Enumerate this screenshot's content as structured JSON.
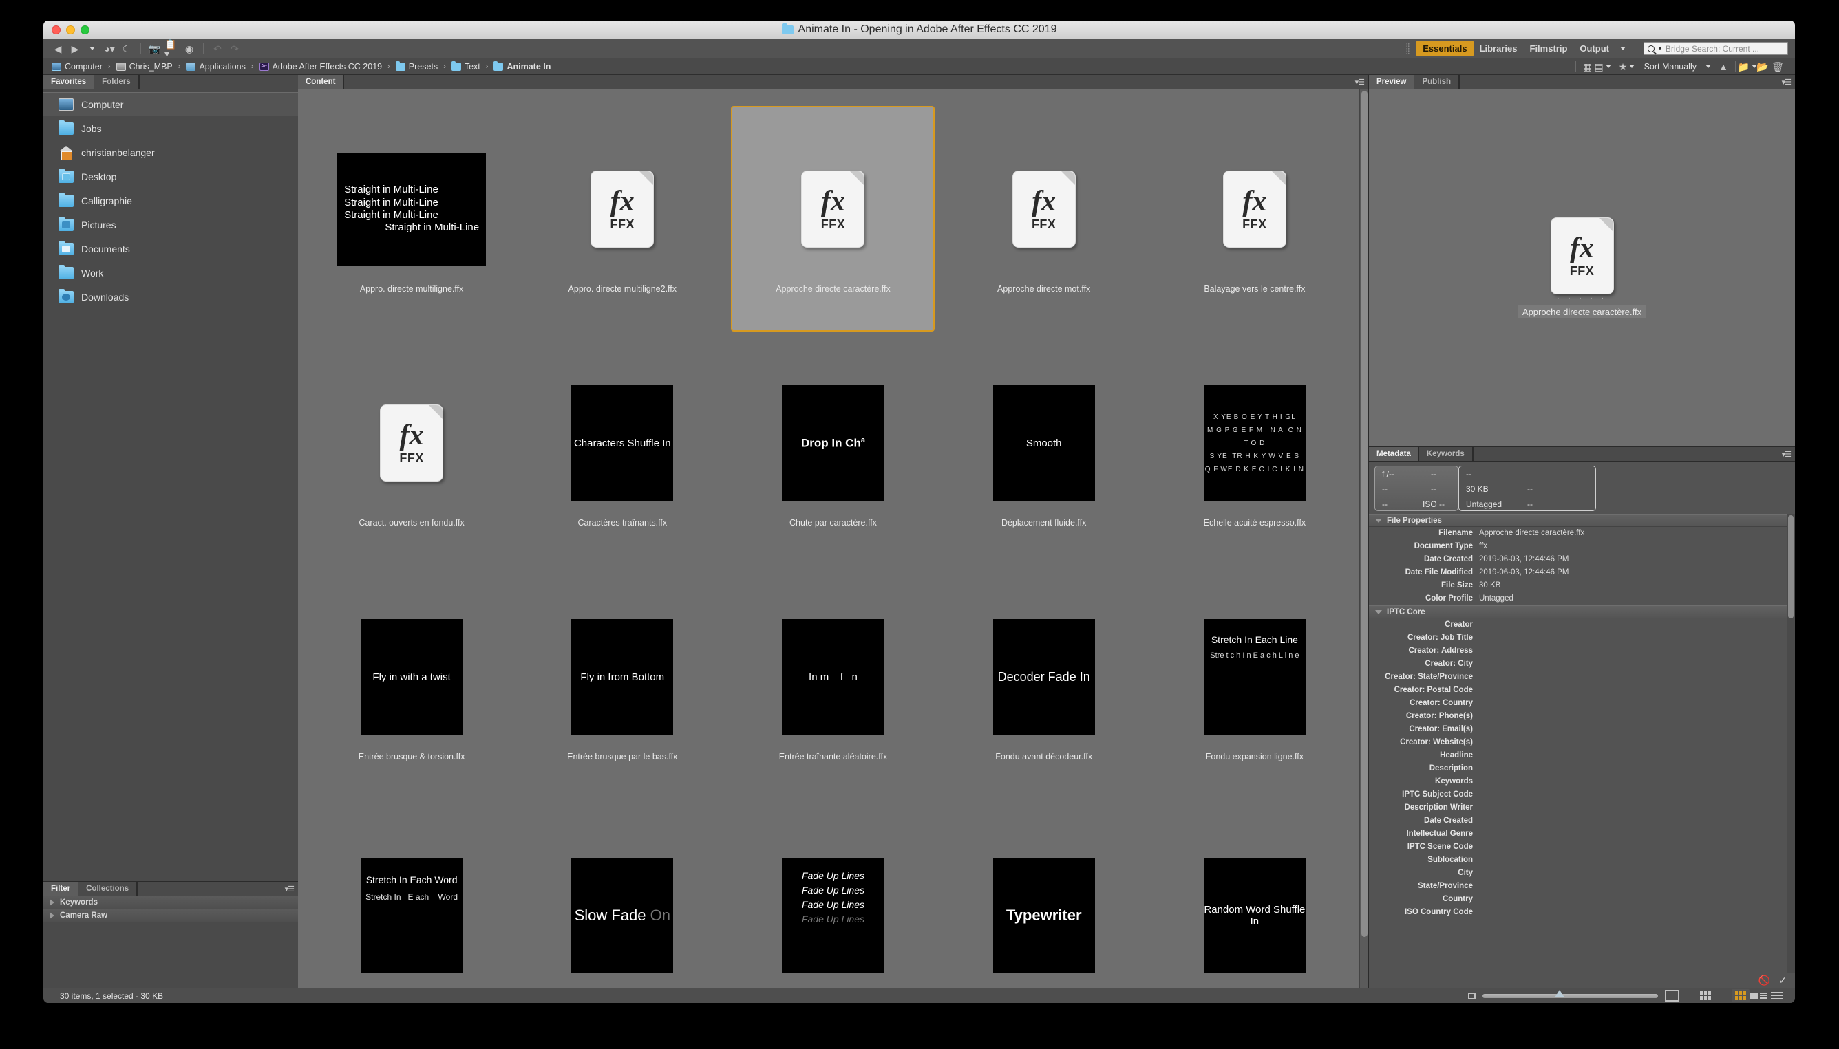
{
  "window": {
    "title": "Animate In - Opening in Adobe After Effects CC 2019"
  },
  "toolbar": {
    "workspaces": [
      {
        "label": "Essentials",
        "active": true
      },
      {
        "label": "Libraries",
        "active": false
      },
      {
        "label": "Filmstrip",
        "active": false
      },
      {
        "label": "Output",
        "active": false
      }
    ],
    "search_placeholder": "Bridge Search: Current ...",
    "icons": [
      "back-arrow-icon",
      "forward-arrow-icon",
      "recent-dropdown-icon",
      "reveal-icon",
      "boomerang-icon",
      "get-photos-camera-icon",
      "refine-copy-icon",
      "open-in-camera-raw-icon",
      "rotate-ccw-icon",
      "rotate-cw-icon"
    ]
  },
  "pathbar": {
    "crumbs": [
      {
        "label": "Computer",
        "icon": "computer-icon"
      },
      {
        "label": "Chris_MBP",
        "icon": "disk-icon"
      },
      {
        "label": "Applications",
        "icon": "applications-icon"
      },
      {
        "label": "Adobe After Effects CC 2019",
        "icon": "after-effects-icon"
      },
      {
        "label": "Presets",
        "icon": "folder-icon"
      },
      {
        "label": "Text",
        "icon": "folder-icon"
      },
      {
        "label": "Animate In",
        "icon": "folder-icon"
      }
    ],
    "separator": "›"
  },
  "content_toolbar": {
    "thumbnail_quality_label": "thumbnail-quality-icon",
    "preview_quality_label": "preview-quality-icon",
    "rating_filter_label": "star-filter-icon",
    "sort_label": "Sort Manually",
    "sort_direction": "ascending",
    "new_folder_label": "new-folder-icon",
    "delete_label": "trash-icon"
  },
  "sidebar": {
    "tabs": [
      {
        "label": "Favorites",
        "active": true
      },
      {
        "label": "Folders",
        "active": false
      }
    ],
    "items": [
      {
        "label": "Computer",
        "icon": "computer-icon",
        "selected": true
      },
      {
        "label": "Jobs",
        "icon": "folder-icon",
        "selected": false
      },
      {
        "label": "christianbelanger",
        "icon": "home-icon",
        "selected": false
      },
      {
        "label": "Desktop",
        "icon": "desktop-folder-icon",
        "selected": false
      },
      {
        "label": "Calligraphie",
        "icon": "folder-icon",
        "selected": false
      },
      {
        "label": "Pictures",
        "icon": "pictures-folder-icon",
        "selected": false
      },
      {
        "label": "Documents",
        "icon": "documents-folder-icon",
        "selected": false
      },
      {
        "label": "Work",
        "icon": "folder-icon",
        "selected": false
      },
      {
        "label": "Downloads",
        "icon": "downloads-folder-icon",
        "selected": false
      }
    ]
  },
  "filter_panel": {
    "tabs": [
      {
        "label": "Filter",
        "active": true
      },
      {
        "label": "Collections",
        "active": false
      }
    ],
    "rows": [
      {
        "label": "Keywords"
      },
      {
        "label": "Camera Raw"
      }
    ]
  },
  "content": {
    "tabs": [
      {
        "label": "Content",
        "active": true
      }
    ],
    "items": [
      {
        "caption": "Appro. directe multiligne.ffx",
        "thumb": "text-lines",
        "selected": false,
        "lines": [
          "Straight in Multi-Line",
          "Straight in Multi-Line",
          "Straight in Multi-Line",
          "Straight in Multi-Line"
        ],
        "indent_last": true
      },
      {
        "caption": "Appro. directe multiligne2.ffx",
        "thumb": "ffx-icon",
        "selected": false,
        "ffx_label": "FFX"
      },
      {
        "caption": "Approche directe caractère.ffx",
        "thumb": "ffx-icon",
        "selected": true,
        "ffx_label": "FFX"
      },
      {
        "caption": "Approche directe mot.ffx",
        "thumb": "ffx-icon",
        "selected": false,
        "ffx_label": "FFX"
      },
      {
        "caption": "Balayage vers le centre.ffx",
        "thumb": "ffx-icon",
        "selected": false,
        "ffx_label": "FFX"
      },
      {
        "caption": "Caract. ouverts en fondu.ffx",
        "thumb": "ffx-icon",
        "selected": false,
        "ffx_label": "FFX"
      },
      {
        "caption": "Caractères traînants.ffx",
        "thumb": "text-center",
        "selected": false,
        "text": "Characters Shuffle In"
      },
      {
        "caption": "Chute par caractère.ffx",
        "thumb": "drop-in",
        "selected": false,
        "text": "Drop In Ch",
        "sup": "a"
      },
      {
        "caption": "Déplacement fluide.ffx",
        "thumb": "smooth",
        "selected": false,
        "text": "Smooth"
      },
      {
        "caption": "Echelle acuité espresso.ffx",
        "thumb": "scatter",
        "selected": false,
        "scatter": [
          "X YE B O E Y T H I GL",
          "M G P G E F M I N A  C N T O D",
          "S YE  TR H K Y W V E S",
          "Q F WE D K E C I C I K I N"
        ]
      },
      {
        "caption": "Entrée brusque & torsion.ffx",
        "thumb": "text-center",
        "selected": false,
        "text": "Fly in with a twist"
      },
      {
        "caption": "Entrée brusque par le bas.ffx",
        "thumb": "text-center",
        "selected": false,
        "text": "Fly in from Bottom"
      },
      {
        "caption": "Entrée traînante aléatoire.ffx",
        "thumb": "text-center",
        "selected": false,
        "text": "In m    f   n"
      },
      {
        "caption": "Fondu avant décodeur.ffx",
        "thumb": "text-center",
        "selected": false,
        "text": "Decoder Fade In"
      },
      {
        "caption": "Fondu expansion ligne.ffx",
        "thumb": "stretch-line",
        "selected": false,
        "line1": "Stretch In Each Line",
        "line2": "Stre t c h  I n  E a c h L i n e"
      },
      {
        "caption": "",
        "thumb": "stretch-word",
        "selected": false,
        "line1": "Stretch In Each Word",
        "line2": "Stretch  In   E ach    Word"
      },
      {
        "caption": "",
        "thumb": "slow-fade",
        "selected": false,
        "text": "Slow Fade",
        "faded": "On"
      },
      {
        "caption": "",
        "thumb": "fade-up-lines",
        "selected": false,
        "lines": [
          "Fade Up Lines",
          "Fade Up Lines",
          "Fade Up Lines",
          "Fade Up Lines"
        ]
      },
      {
        "caption": "",
        "thumb": "text-center",
        "selected": false,
        "text": "Typewriter"
      },
      {
        "caption": "",
        "thumb": "text-center",
        "selected": false,
        "text": "Random Word Shuffle In"
      }
    ]
  },
  "preview": {
    "tabs": [
      {
        "label": "Preview",
        "active": true
      },
      {
        "label": "Publish",
        "active": false
      }
    ],
    "ffx_label": "FFX",
    "caption": "Approche directe caractère.ffx",
    "dots": "· · · · ·"
  },
  "metadata": {
    "tabs": [
      {
        "label": "Metadata",
        "active": true
      },
      {
        "label": "Keywords",
        "active": false
      }
    ],
    "plate_left": [
      "f /--",
      "--",
      "--",
      "--",
      "--",
      "ISO --"
    ],
    "plate_right": [
      "--",
      "",
      "30 KB",
      "--",
      "Untagged",
      "--"
    ],
    "sections": [
      {
        "title": "File Properties",
        "rows": [
          {
            "key": "Filename",
            "value": "Approche directe caractère.ffx"
          },
          {
            "key": "Document Type",
            "value": "ffx"
          },
          {
            "key": "Date Created",
            "value": "2019-06-03, 12:44:46 PM"
          },
          {
            "key": "Date File Modified",
            "value": "2019-06-03, 12:44:46 PM"
          },
          {
            "key": "File Size",
            "value": "30 KB"
          },
          {
            "key": "Color Profile",
            "value": "Untagged"
          }
        ]
      },
      {
        "title": "IPTC Core",
        "rows": [
          {
            "key": "Creator",
            "value": ""
          },
          {
            "key": "Creator: Job Title",
            "value": ""
          },
          {
            "key": "Creator: Address",
            "value": ""
          },
          {
            "key": "Creator: City",
            "value": ""
          },
          {
            "key": "Creator: State/Province",
            "value": ""
          },
          {
            "key": "Creator: Postal Code",
            "value": ""
          },
          {
            "key": "Creator: Country",
            "value": ""
          },
          {
            "key": "Creator: Phone(s)",
            "value": ""
          },
          {
            "key": "Creator: Email(s)",
            "value": ""
          },
          {
            "key": "Creator: Website(s)",
            "value": ""
          },
          {
            "key": "Headline",
            "value": ""
          },
          {
            "key": "Description",
            "value": ""
          },
          {
            "key": "Keywords",
            "value": ""
          },
          {
            "key": "IPTC Subject Code",
            "value": ""
          },
          {
            "key": "Description Writer",
            "value": ""
          },
          {
            "key": "Date Created",
            "value": ""
          },
          {
            "key": "Intellectual Genre",
            "value": ""
          },
          {
            "key": "IPTC Scene Code",
            "value": ""
          },
          {
            "key": "Sublocation",
            "value": ""
          },
          {
            "key": "City",
            "value": ""
          },
          {
            "key": "State/Province",
            "value": ""
          },
          {
            "key": "Country",
            "value": ""
          },
          {
            "key": "ISO Country Code",
            "value": ""
          }
        ]
      }
    ]
  },
  "statusbar": {
    "text": "30 items, 1 selected - 30 KB",
    "view_buttons": [
      "grid-lock-icon",
      "thumbnail-view-icon",
      "details-view-icon",
      "list-view-icon"
    ]
  },
  "colors": {
    "accent": "#d79a20",
    "window_chrome": "#535353",
    "content_bg": "#6e6e6e",
    "panel_bg": "#4a4a4a"
  }
}
